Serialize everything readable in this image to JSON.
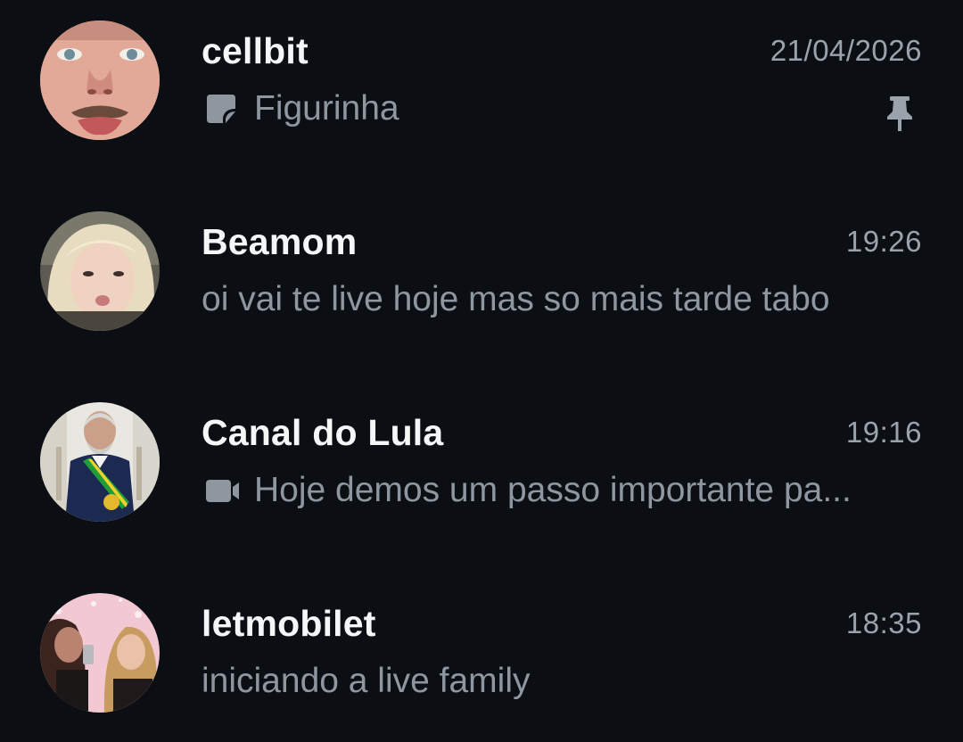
{
  "chats": [
    {
      "name": "cellbit",
      "time": "21/04/2026",
      "preview_icon": "sticker-icon",
      "preview": "Figurinha",
      "pinned": true
    },
    {
      "name": "Beamom",
      "time": "19:26",
      "preview_icon": "",
      "preview": "oi vai te live hoje mas so mais tarde tabo",
      "pinned": false
    },
    {
      "name": "Canal do Lula",
      "time": "19:16",
      "preview_icon": "video-icon",
      "preview": "Hoje demos um passo importante pa...",
      "pinned": false
    },
    {
      "name": "letmobilet",
      "time": "18:35",
      "preview_icon": "",
      "preview": "iniciando a live family",
      "pinned": false
    }
  ],
  "colors": {
    "background": "#0b0f14",
    "name": "#f4f6f8",
    "secondary": "#8e979f"
  }
}
